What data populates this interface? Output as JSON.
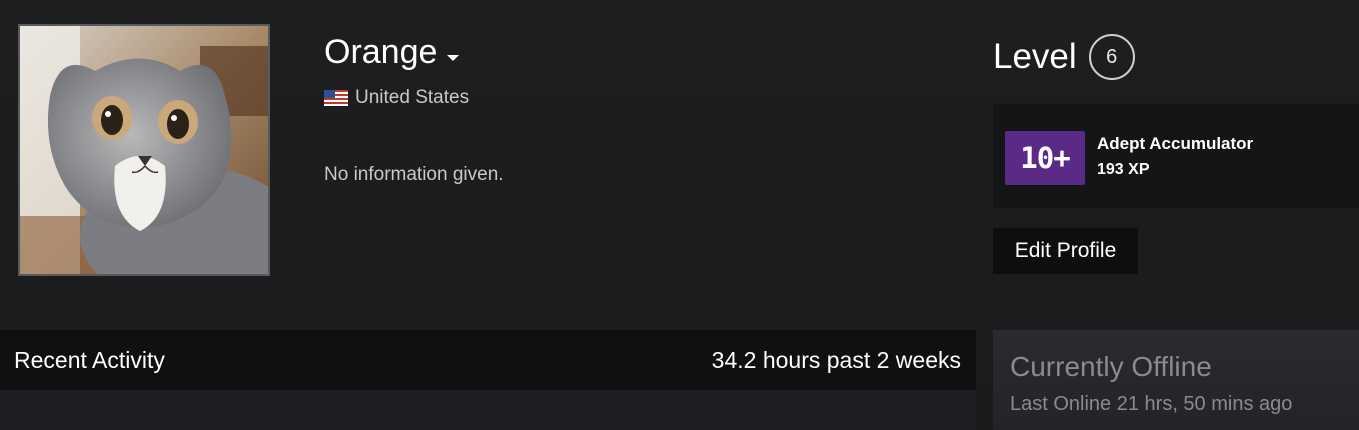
{
  "profile": {
    "persona_name": "Orange",
    "location": "United States",
    "summary": "No information given."
  },
  "level": {
    "label": "Level",
    "value": "6"
  },
  "badge": {
    "icon_text": "10+",
    "name": "Adept Accumulator",
    "xp": "193 XP",
    "icon_color": "#5b2a86"
  },
  "actions": {
    "edit_profile": "Edit Profile"
  },
  "activity": {
    "title": "Recent Activity",
    "hours": "34.2 hours past 2 weeks"
  },
  "status": {
    "title": "Currently Offline",
    "last_online": "Last Online 21 hrs, 50 mins ago"
  },
  "icons": {
    "avatar": "cat-photo",
    "flag": "us-flag-icon",
    "dropdown": "caret-down-icon"
  }
}
